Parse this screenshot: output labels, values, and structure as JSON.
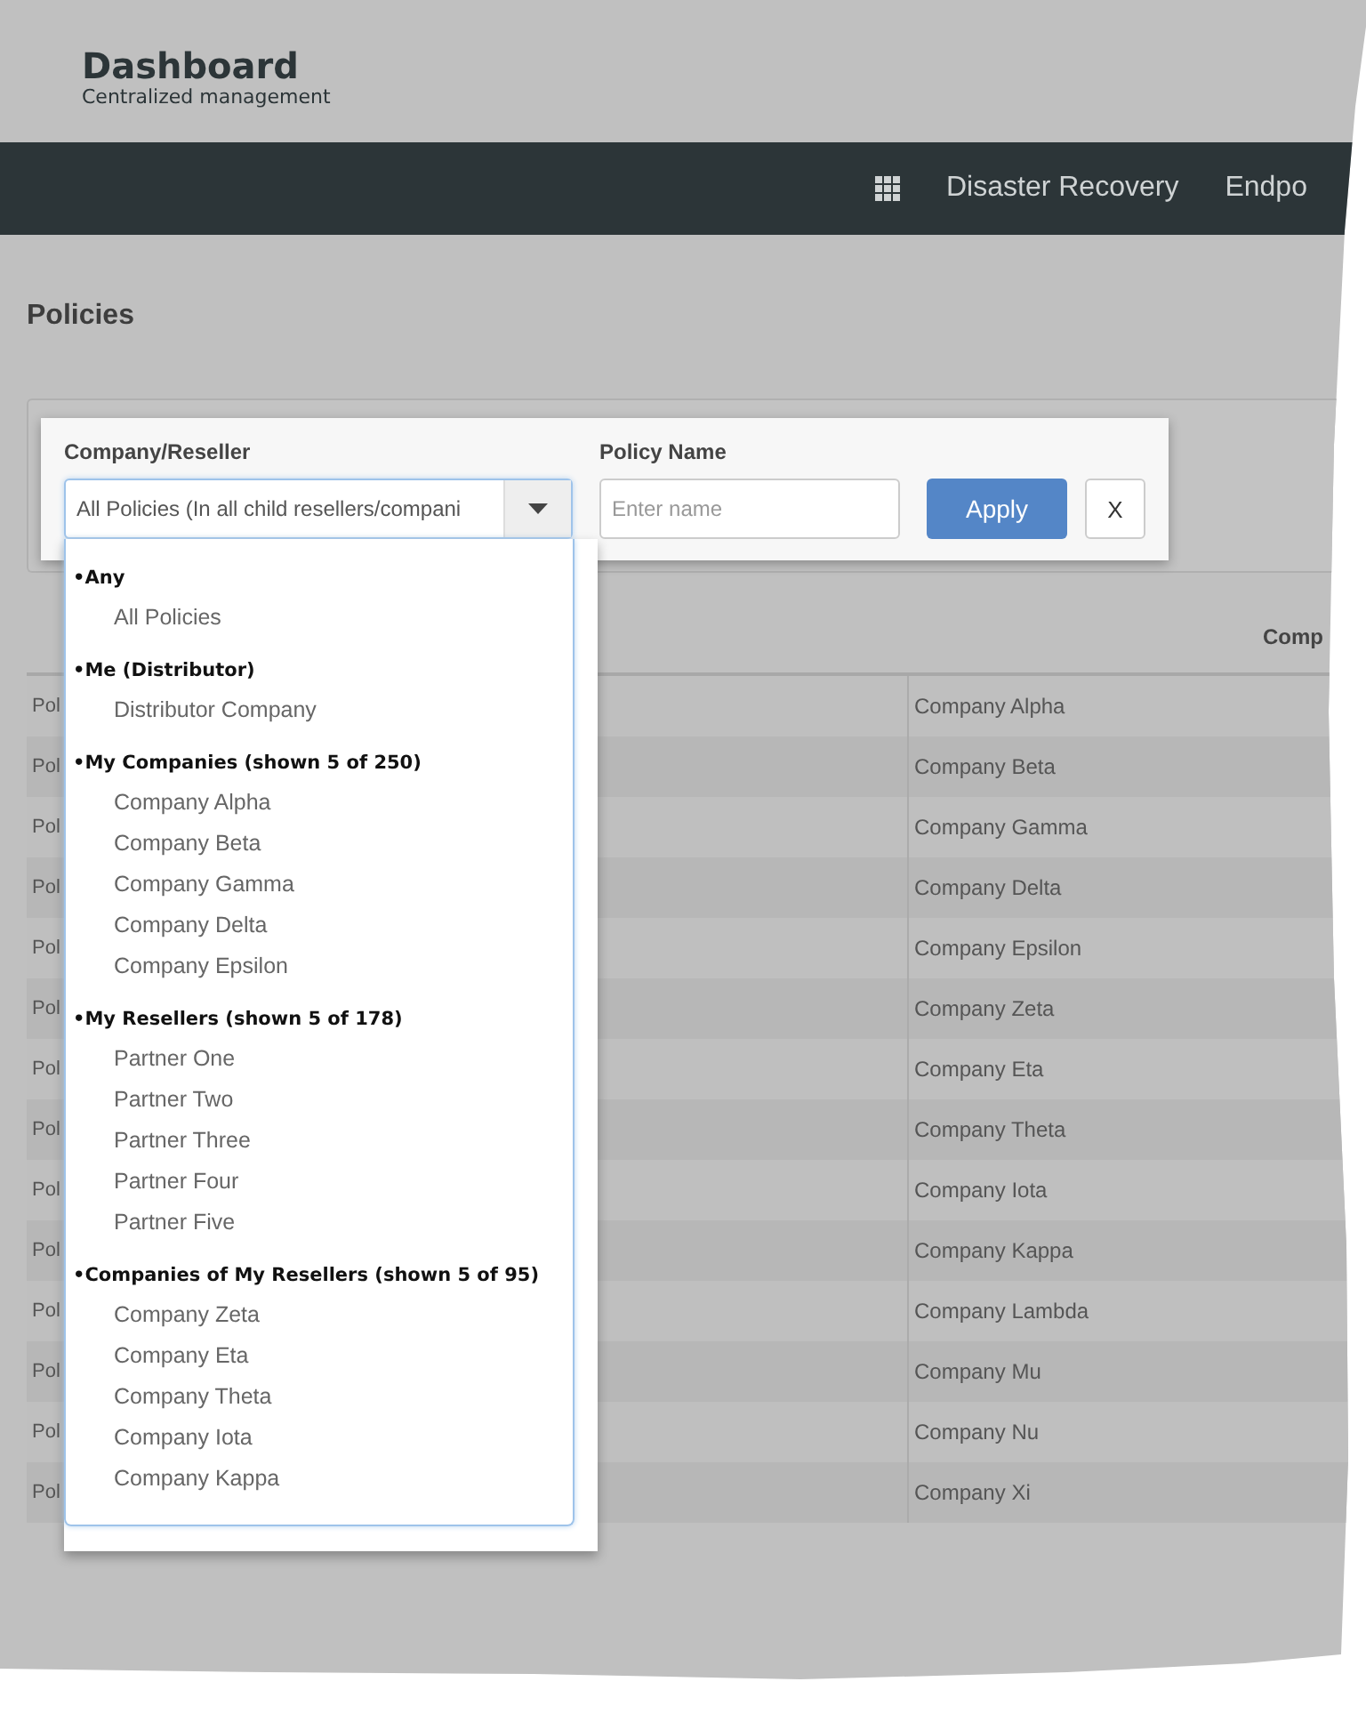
{
  "header": {
    "title": "Dashboard",
    "subtitle": "Centralized management"
  },
  "nav": {
    "items": [
      "Disaster Recovery",
      "Endpo"
    ]
  },
  "page_title": "Policies",
  "filters": {
    "company": {
      "label": "Company/Reseller",
      "value": "All Policies (In all child resellers/compani"
    },
    "policy_name": {
      "label": "Policy Name",
      "placeholder": "Enter name"
    },
    "apply": "Apply",
    "clear": "X"
  },
  "dropdown": {
    "groups": [
      {
        "heading": "•Any",
        "options": [
          "All Policies"
        ]
      },
      {
        "heading": "•Me (Distributor)",
        "options": [
          "Distributor Company"
        ]
      },
      {
        "heading": "•My Companies (shown 5 of 250)",
        "options": [
          "Company Alpha",
          "Company Beta",
          "Company Gamma",
          "Company Delta",
          "Company Epsilon"
        ]
      },
      {
        "heading": "•My Resellers (shown 5 of 178)",
        "options": [
          "Partner One",
          "Partner Two",
          "Partner Three",
          "Partner Four",
          "Partner Five"
        ]
      },
      {
        "heading": "•Companies of My Resellers (shown 5 of 95)",
        "options": [
          "Company Zeta",
          "Company Eta",
          "Company Theta",
          "Company Iota",
          "Company Kappa"
        ]
      }
    ]
  },
  "table": {
    "header": {
      "column_3": "Comp"
    },
    "rows": [
      {
        "column_1": "Pol",
        "column_2": "Company Alpha"
      },
      {
        "column_1": "Pol",
        "column_2": "Company Beta"
      },
      {
        "column_1": "Pol",
        "column_2": "Company Gamma"
      },
      {
        "column_1": "Pol",
        "column_2": "Company Delta"
      },
      {
        "column_1": "Pol",
        "column_2": "Company Epsilon"
      },
      {
        "column_1": "Pol",
        "column_2": "Company Zeta"
      },
      {
        "column_1": "Pol",
        "column_2": "Company Eta"
      },
      {
        "column_1": "Pol",
        "column_2": "Company Theta"
      },
      {
        "column_1": "Pol",
        "column_2": "Company Iota"
      },
      {
        "column_1": "Pol",
        "column_2": "Company Kappa"
      },
      {
        "column_1": "Pol",
        "column_2": "Company Lambda"
      },
      {
        "column_1": "Pol",
        "column_2": "Company Mu"
      },
      {
        "column_1": "Pol",
        "column_2": "Company Nu"
      },
      {
        "column_1": "Pol",
        "column_2": "Company Xi"
      }
    ]
  }
}
